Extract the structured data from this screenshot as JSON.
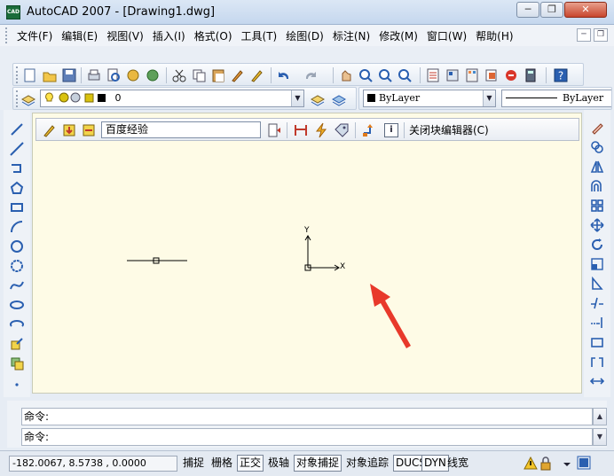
{
  "window": {
    "title": "AutoCAD 2007 - [Drawing1.dwg]",
    "app_icon_text": "CAD",
    "minimize_glyph": "─",
    "restore_glyph": "❐",
    "close_glyph": "✕"
  },
  "menubar": {
    "items": [
      "文件(F)",
      "编辑(E)",
      "视图(V)",
      "插入(I)",
      "格式(O)",
      "工具(T)",
      "绘图(D)",
      "标注(N)",
      "修改(M)",
      "窗口(W)",
      "帮助(H)"
    ],
    "doc_min_glyph": "─",
    "doc_restore_glyph": "❐",
    "doc_close_glyph": "✕"
  },
  "layers_toolbar": {
    "layer_value": "0",
    "color_value": "ByLayer",
    "linetype_value": "ByLayer"
  },
  "block_editor": {
    "block_name": "百度经验",
    "close_label": "关闭块编辑器(C)",
    "info_glyph": "i"
  },
  "ucs": {
    "x_label": "X",
    "y_label": "Y"
  },
  "command": {
    "line1": "命令:",
    "line2": "命令:"
  },
  "status": {
    "coords": "-182.0067, 8.5738 , 0.0000",
    "buttons": [
      {
        "label": "捕捉",
        "on": false
      },
      {
        "label": "栅格",
        "on": false
      },
      {
        "label": "正交",
        "on": true
      },
      {
        "label": "极轴",
        "on": false
      },
      {
        "label": "对象捕捉",
        "on": true
      },
      {
        "label": "对象追踪",
        "on": false
      },
      {
        "label": "DUCS",
        "on": true
      },
      {
        "label": "DYN",
        "on": true
      },
      {
        "label": "线宽",
        "on": false
      }
    ]
  },
  "colors": {
    "canvas_bg": "#fefbe6",
    "arrow_red": "#e8392b",
    "accent_blue": "#2a5fb0"
  }
}
